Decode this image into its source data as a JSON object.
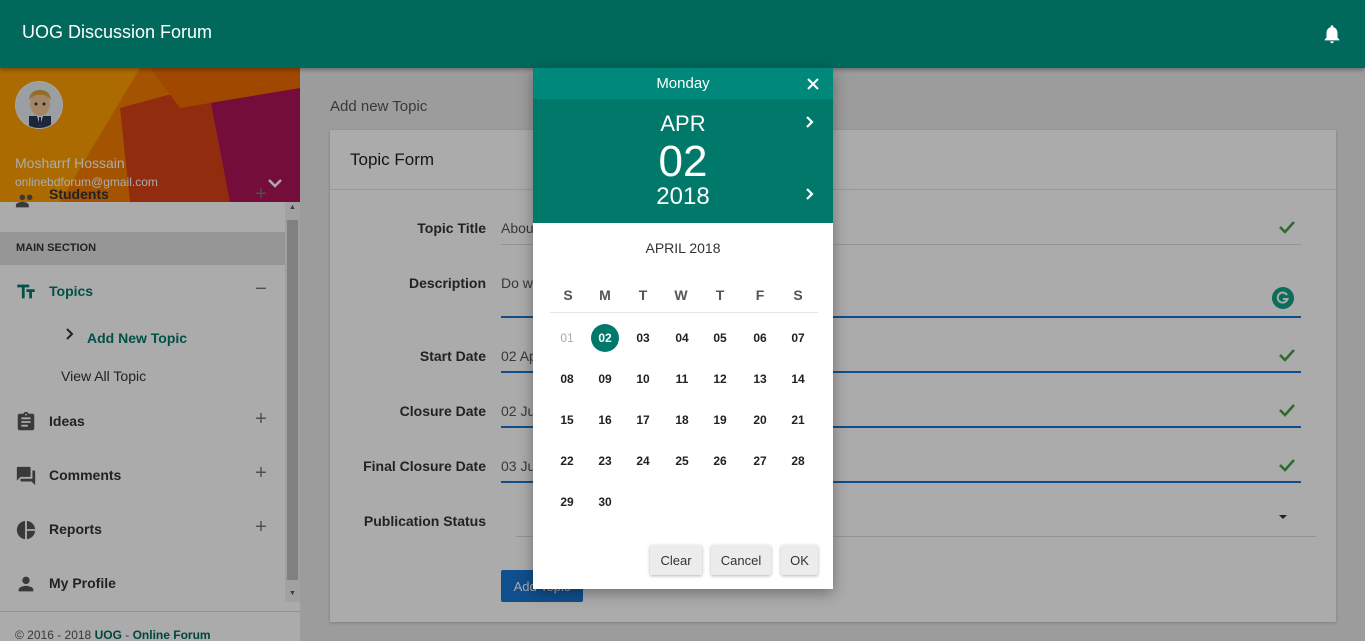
{
  "app": {
    "title": "UOG Discussion Forum"
  },
  "user": {
    "name": "Mosharrf Hossain",
    "email": "onlinebdforum@gmail.com"
  },
  "sidebar": {
    "partial_item": "Students",
    "section_header": "MAIN SECTION",
    "items": [
      {
        "label": "Topics",
        "toggle": "−"
      },
      {
        "label": "Ideas",
        "toggle": "+"
      },
      {
        "label": "Comments",
        "toggle": "+"
      },
      {
        "label": "Reports",
        "toggle": "+"
      },
      {
        "label": "My Profile"
      }
    ],
    "subitems": [
      {
        "label": "Add New Topic"
      },
      {
        "label": "View All Topic"
      }
    ],
    "footer_prefix": "© 2016 - 2018 ",
    "footer_link1": "UOG",
    "footer_sep": " - ",
    "footer_link2": "Online Forum"
  },
  "main": {
    "breadcrumb": "Add new Topic",
    "form": {
      "title": "Topic Form",
      "fields": [
        {
          "label": "Topic Title",
          "value": "Abou"
        },
        {
          "label": "Description",
          "value": "Do w"
        },
        {
          "label": "Start Date",
          "value": "02 Ap"
        },
        {
          "label": "Closure Date",
          "value": "02 Ju"
        },
        {
          "label": "Final Closure Date",
          "value": "03 Ju"
        },
        {
          "label": "Publication Status",
          "value": ""
        }
      ],
      "submit": "Add Topic"
    }
  },
  "datepicker": {
    "weekday": "Monday",
    "month": "APR",
    "day": "02",
    "year": "2018",
    "month_title": "APRIL 2018",
    "weekdays": [
      "S",
      "M",
      "T",
      "W",
      "T",
      "F",
      "S"
    ],
    "weeks": [
      [
        "01",
        "02",
        "03",
        "04",
        "05",
        "06",
        "07"
      ],
      [
        "08",
        "09",
        "10",
        "11",
        "12",
        "13",
        "14"
      ],
      [
        "15",
        "16",
        "17",
        "18",
        "19",
        "20",
        "21"
      ],
      [
        "22",
        "23",
        "24",
        "25",
        "26",
        "27",
        "28"
      ],
      [
        "29",
        "30"
      ]
    ],
    "selected": "02",
    "buttons": {
      "clear": "Clear",
      "cancel": "Cancel",
      "ok": "OK"
    }
  },
  "colors": {
    "primary": "#00695c",
    "accent": "#00796b",
    "link": "#1976d2",
    "check": "#43a047"
  }
}
